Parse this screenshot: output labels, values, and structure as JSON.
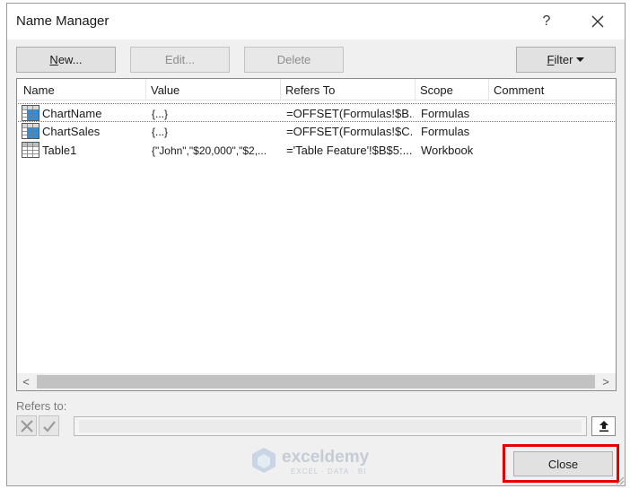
{
  "dialog": {
    "title": "Name Manager",
    "help_label": "?",
    "close_icon": "close-icon"
  },
  "toolbar": {
    "new_prefix": "N",
    "new_rest": "ew...",
    "edit_label": "Edit...",
    "delete_label": "Delete",
    "filter_prefix": "F",
    "filter_rest": "ilter",
    "filter_icon": "caret-down-icon"
  },
  "table": {
    "headers": [
      "Name",
      "Value",
      "Refers To",
      "Scope",
      "Comment"
    ],
    "rows": [
      {
        "icon": "named-range-icon",
        "name": "ChartName",
        "value": "{...}",
        "refers_to": "=OFFSET(Formulas!$B...",
        "scope": "Formulas",
        "comment": ""
      },
      {
        "icon": "named-range-icon",
        "name": "ChartSales",
        "value": "{...}",
        "refers_to": "=OFFSET(Formulas!$C...",
        "scope": "Formulas",
        "comment": ""
      },
      {
        "icon": "table-icon",
        "name": "Table1",
        "value": "{\"John\",\"$20,000\",\"$2,...",
        "refers_to": "='Table Feature'!$B$5:...",
        "scope": "Workbook",
        "comment": ""
      }
    ]
  },
  "scrollbar": {
    "left_arrow": "<",
    "right_arrow": ">"
  },
  "refers_to": {
    "label": "Refers to:",
    "value": "",
    "cancel_icon": "cancel-x-icon",
    "confirm_icon": "checkmark-icon",
    "collapse_icon": "collapse-dialog-icon"
  },
  "watermark": {
    "name": "exceldemy",
    "tagline": "EXCEL · DATA · BI"
  },
  "footer": {
    "close_label": "Close"
  },
  "colors": {
    "highlight_border": "#e60000",
    "dialog_bg": "#f0f0f0"
  }
}
